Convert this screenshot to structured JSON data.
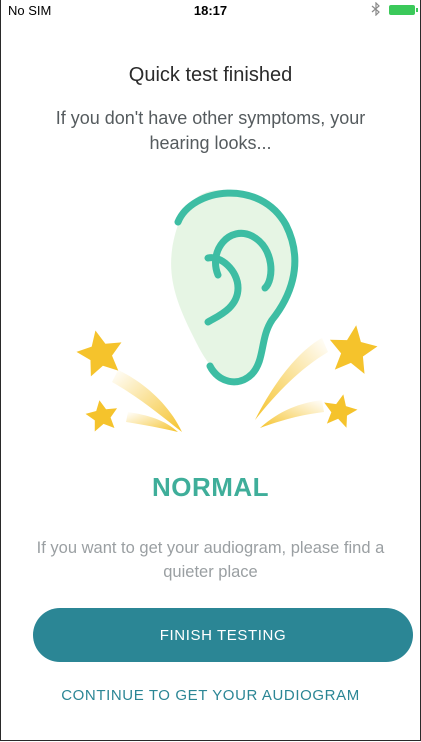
{
  "status_bar": {
    "carrier": "No SIM",
    "time": "18:17",
    "bluetooth_icon": "bluetooth-icon",
    "battery_icon": "battery-icon",
    "battery_color": "#3bc95a"
  },
  "screen": {
    "title": "Quick test finished",
    "subtitle": "If you don't have other symptoms, your hearing looks...",
    "illustration_icon": "ear-with-stars-icon",
    "result": "NORMAL",
    "hint": "If you want to get your audiogram, please find a quieter place"
  },
  "actions": {
    "finish_label": "FINISH TESTING",
    "continue_label": "CONTINUE TO GET YOUR AUDIOGRAM"
  },
  "colors": {
    "accent": "#2b8695",
    "result": "#3fae9a",
    "ear_outline": "#3dbda3",
    "ear_fill": "#e6f5e4",
    "star": "#f5c32c"
  }
}
